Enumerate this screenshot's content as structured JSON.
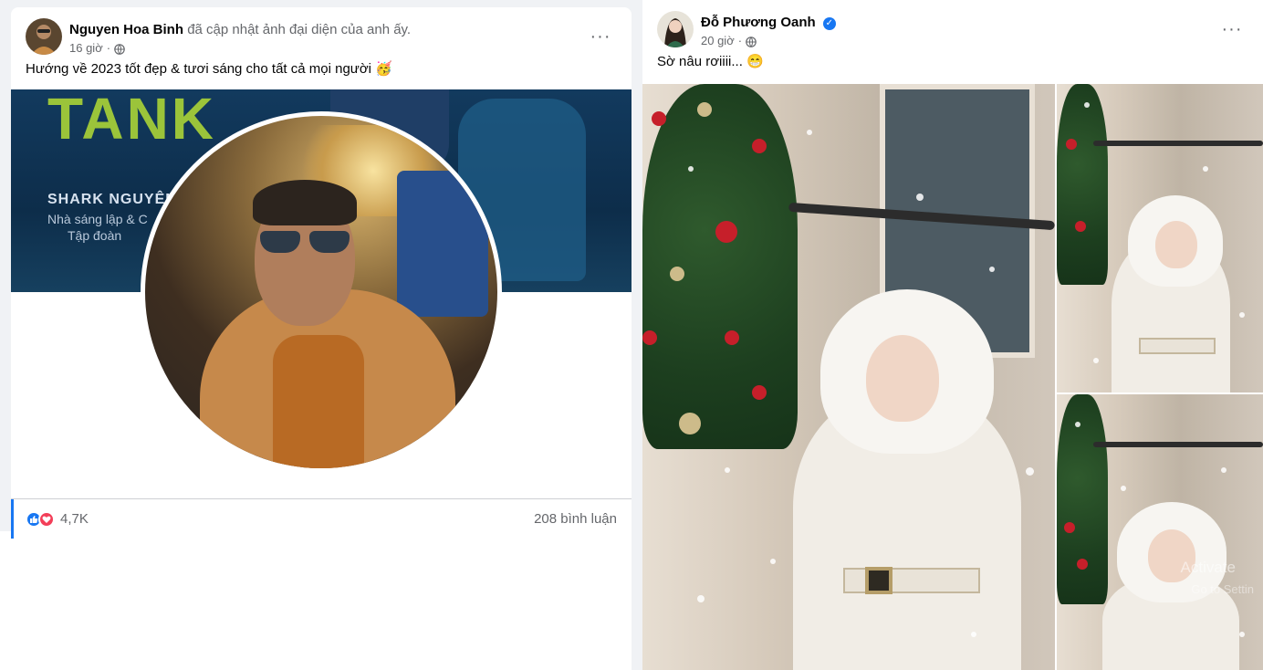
{
  "left_post": {
    "author": "Nguyen Hoa Binh",
    "action": "đã cập nhật ảnh đại diện của anh ấy.",
    "time": "16 giờ",
    "caption": "Hướng về 2023 tốt đẹp & tươi sáng cho tất cả mọi người 🥳",
    "cover": {
      "title": "TANK",
      "name": "SHARK NGUYÊN",
      "line1": "Nhà sáng lập & C",
      "line2": "Tập đoàn"
    },
    "reaction_count": "4,7K",
    "comments": "208 bình luận",
    "more": "···"
  },
  "right_post": {
    "author": "Đỗ Phương Oanh",
    "time": "20 giờ",
    "caption": "Sờ nâu rơiiii... 😁",
    "more": "···"
  },
  "watermark": {
    "line1": "Activate",
    "line2": "Go to Settin"
  },
  "icons": {
    "globe": "globe-icon",
    "verified": "verified-badge-icon",
    "like": "like-reaction-icon",
    "love": "love-reaction-icon"
  },
  "colors": {
    "accent": "#1877f2",
    "love": "#f33e58",
    "secondary_text": "#65676b"
  }
}
